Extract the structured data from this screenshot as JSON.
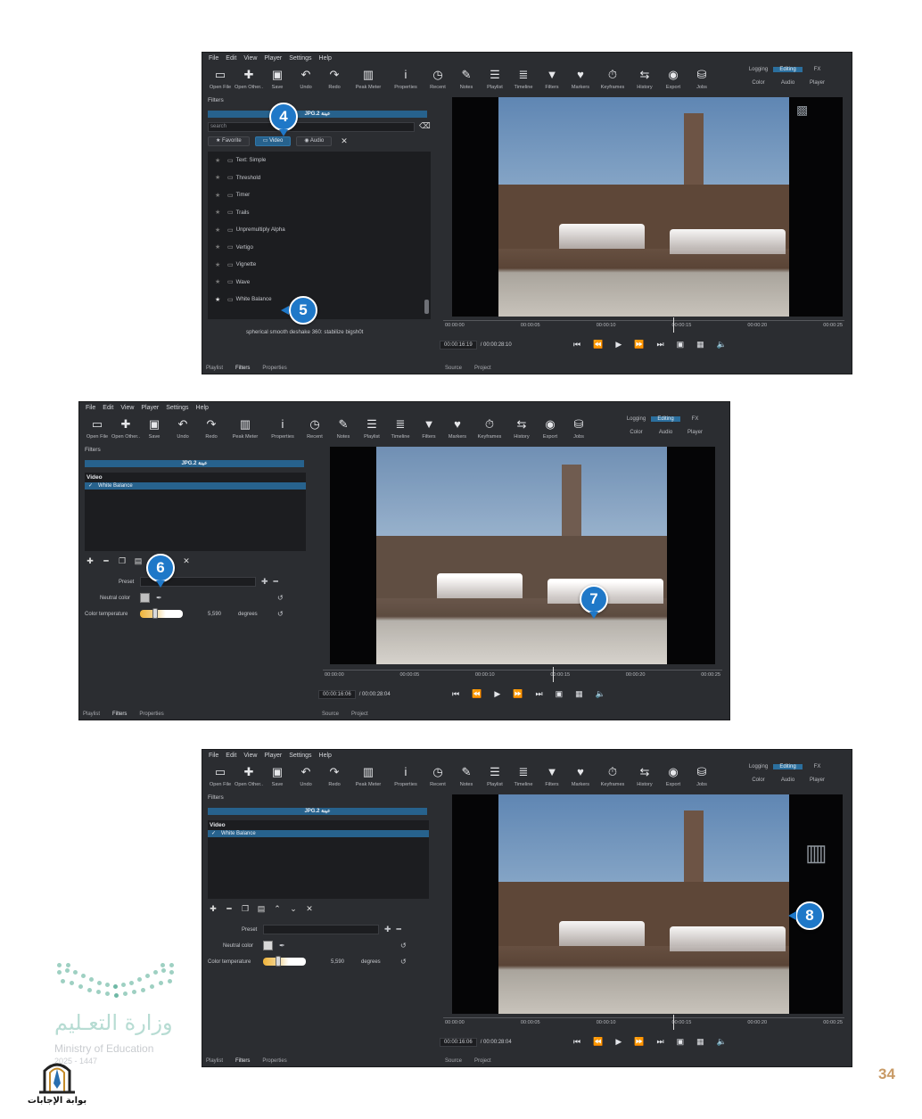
{
  "menu": [
    "File",
    "Edit",
    "View",
    "Player",
    "Settings",
    "Help"
  ],
  "toolbar": [
    "Open File",
    "Open Other..",
    "Save",
    "Undo",
    "Redo",
    "Peak Meter",
    "Properties",
    "Recent",
    "Notes",
    "Playlist",
    "Timeline",
    "Filters",
    "Markers",
    "Keyframes",
    "History",
    "Export",
    "Jobs"
  ],
  "layouts": [
    "Logging",
    "Editing",
    "FX",
    "Color",
    "Audio",
    "Player"
  ],
  "filters_title": "Filters",
  "clip_name": "JPG.2 عينة",
  "search_placeholder": "search",
  "filter_tabs": [
    "Favorite",
    "Video",
    "Audio"
  ],
  "filter_list": [
    "Text: Simple",
    "Threshold",
    "Timer",
    "Trails",
    "Unpremultiply Alpha",
    "Vertigo",
    "Vignette",
    "Wave",
    "White Balance"
  ],
  "filter_desc": "spherical smooth deshake 360: stabilize bigsh0t",
  "bottom_tabs": [
    "Playlist",
    "Filters",
    "Properties"
  ],
  "source_tabs": [
    "Source",
    "Project"
  ],
  "ruler": [
    "00:00:00",
    "00:00:05",
    "00:00:10",
    "00:00:15",
    "00:00:20",
    "00:00:25"
  ],
  "shot1": {
    "tc": "00:00:16:19",
    "dur": "/ 00:00:28:10"
  },
  "shot2": {
    "tc": "00:00:16:06",
    "dur": "/ 00:00:28:04"
  },
  "shot3": {
    "tc": "00:00:16:06",
    "dur": "/ 00:00:28:04"
  },
  "active_section": "Video",
  "active_filter": "White Balance",
  "props": {
    "preset": "Preset",
    "neutral": "Neutral color",
    "temp": "Color temperature",
    "value": "5,590",
    "unit": "degrees"
  },
  "callouts": [
    "4",
    "5",
    "6",
    "7",
    "8"
  ],
  "ministry": {
    "ar": "وزارة التعـليم",
    "en": "Ministry of Education",
    "years": "2025 - 1447"
  },
  "badge": "بوابة الإجابات",
  "page_number": "34"
}
